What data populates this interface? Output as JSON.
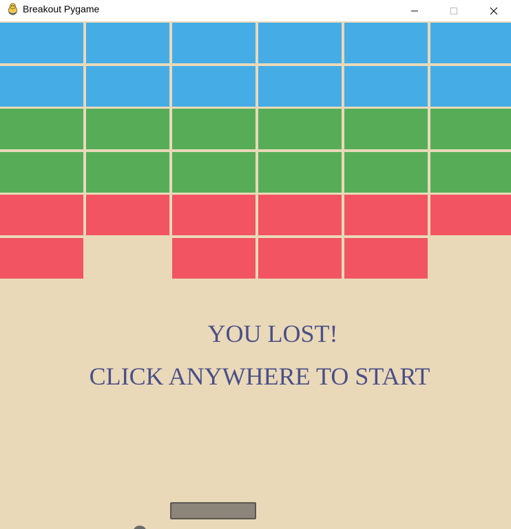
{
  "window": {
    "title": "Breakout Pygame",
    "icon": "pygame-snake-icon",
    "controls": {
      "minimize": "minimize-icon",
      "maximize": "maximize-icon",
      "close": "close-icon"
    }
  },
  "game": {
    "background_color": "#e9d9b9",
    "bricks": {
      "rows": [
        {
          "color": "#46ace6",
          "present": [
            true,
            true,
            true,
            true,
            true,
            true
          ]
        },
        {
          "color": "#46ace6",
          "present": [
            true,
            true,
            true,
            true,
            true,
            true
          ]
        },
        {
          "color": "#57ad57",
          "present": [
            true,
            true,
            true,
            true,
            true,
            true
          ]
        },
        {
          "color": "#57ad57",
          "present": [
            true,
            true,
            true,
            true,
            true,
            true
          ]
        },
        {
          "color": "#f25461",
          "present": [
            true,
            true,
            true,
            true,
            true,
            true
          ]
        },
        {
          "color": "#f25461",
          "present": [
            true,
            false,
            true,
            true,
            true,
            false
          ]
        }
      ]
    },
    "message": {
      "line1": "YOU LOST!",
      "line2": "CLICK ANYWHERE TO START",
      "color": "#4b4f87"
    },
    "paddle_color": "#8b857a",
    "ball_color": "#6a6a6a"
  }
}
